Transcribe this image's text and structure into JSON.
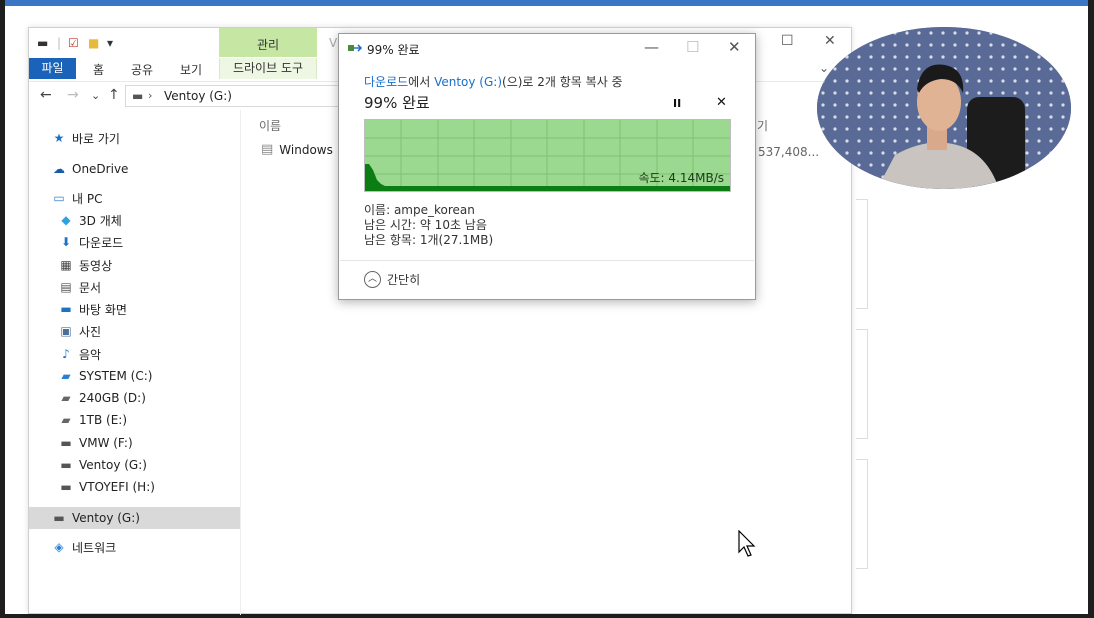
{
  "explorer": {
    "contextual_group": "관리",
    "contextual_group2": "V",
    "ribbon_tabs": {
      "file": "파일",
      "home": "홈",
      "share": "공유",
      "view": "보기",
      "drive_tools": "드라이브 도구"
    },
    "nav": {
      "back": "←",
      "forward": "→",
      "recent": "⌄",
      "up": "↑"
    },
    "address": "Ventoy (G:)",
    "sidebar": [
      {
        "label": "바로 가기",
        "icon": "star-icon"
      },
      {
        "label": "OneDrive",
        "icon": "cloud-icon"
      },
      {
        "label": "내 PC",
        "icon": "computer-icon"
      },
      {
        "label": "3D 개체",
        "icon": "cube-icon"
      },
      {
        "label": "다운로드",
        "icon": "download-icon"
      },
      {
        "label": "동영상",
        "icon": "video-icon"
      },
      {
        "label": "문서",
        "icon": "document-icon"
      },
      {
        "label": "바탕 화면",
        "icon": "desktop-icon"
      },
      {
        "label": "사진",
        "icon": "picture-icon"
      },
      {
        "label": "음악",
        "icon": "music-icon"
      },
      {
        "label": "SYSTEM (C:)",
        "icon": "system-drive-icon"
      },
      {
        "label": "240GB (D:)",
        "icon": "drive-icon"
      },
      {
        "label": "1TB (E:)",
        "icon": "drive-icon"
      },
      {
        "label": "VMW (F:)",
        "icon": "usb-drive-icon"
      },
      {
        "label": "Ventoy (G:)",
        "icon": "usb-drive-icon"
      },
      {
        "label": "VTOYEFI (H:)",
        "icon": "usb-drive-icon"
      },
      {
        "label": "Ventoy (G:)",
        "icon": "usb-drive-icon"
      },
      {
        "label": "네트워크",
        "icon": "network-icon"
      }
    ],
    "column_name": "이름",
    "column_size": "기",
    "files": [
      {
        "name": "Windows",
        "size": "537,408..."
      }
    ]
  },
  "dialog": {
    "title": "99% 완료",
    "source": "다운로드",
    "seg1": "에서 ",
    "dest": "Ventoy (G:)",
    "seg2": "(으)로 2개 항목 복사 중",
    "percent_label": "99% 완료",
    "pause": "II",
    "cancel": "✕",
    "speed": "속도: 4.14MB/s",
    "name_line": "이름: ampe_korean",
    "time_line": "남은 시간: 약 10초 남음",
    "items_line": "남은 항목: 1개(27.1MB)",
    "less_details": "간단히",
    "progress_percent": 99,
    "colors": {
      "graph_bg": "#9bd890",
      "graph_line": "#0b7d12",
      "grid": "#7cc270"
    }
  }
}
